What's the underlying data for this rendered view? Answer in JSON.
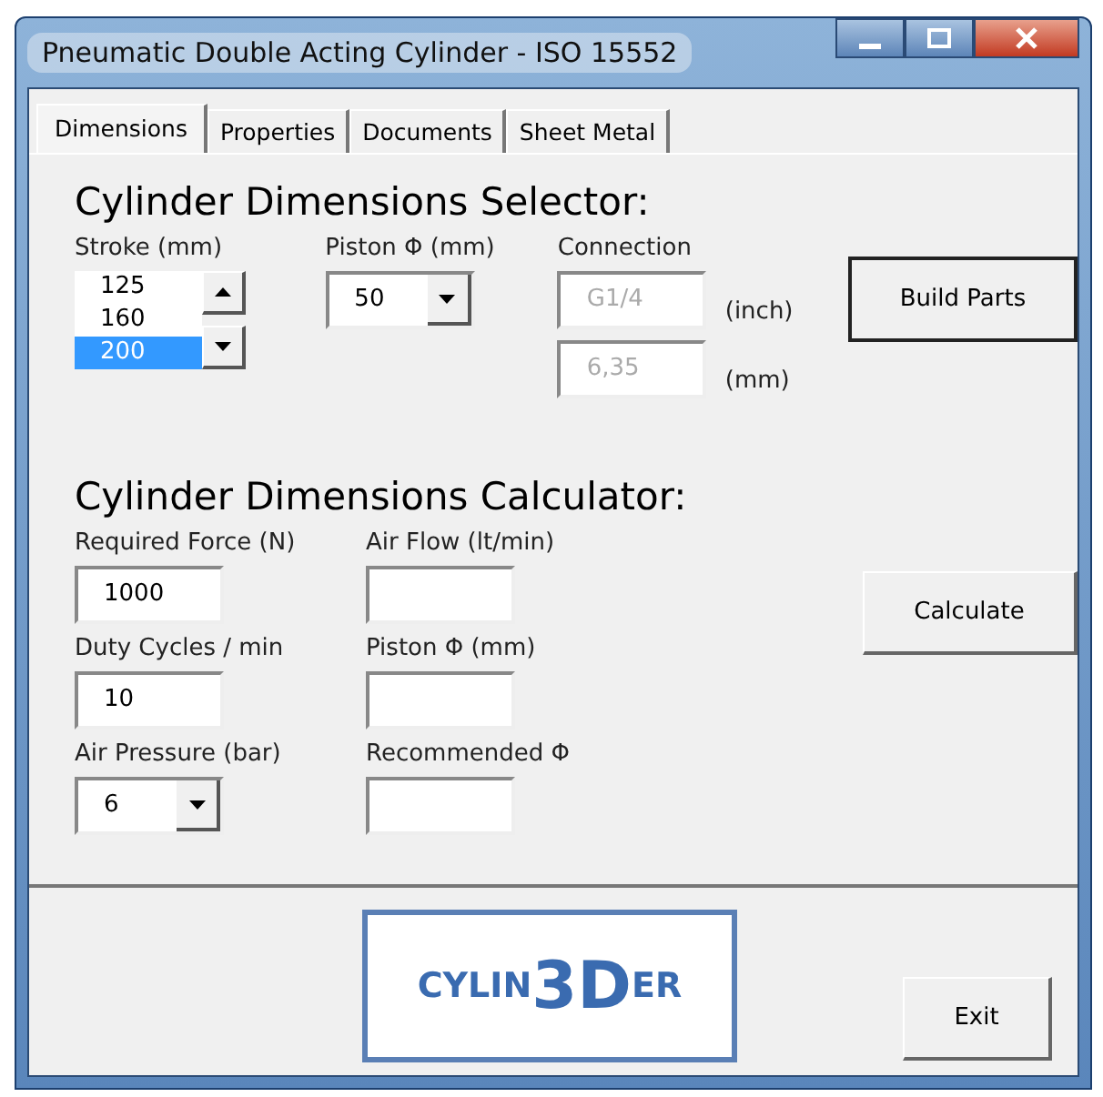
{
  "window": {
    "title": "Pneumatic Double Acting Cylinder - ISO 15552"
  },
  "tabs": [
    {
      "label": "Dimensions",
      "selected": true
    },
    {
      "label": "Properties",
      "selected": false
    },
    {
      "label": "Documents",
      "selected": false
    },
    {
      "label": "Sheet Metal",
      "selected": false
    }
  ],
  "selector": {
    "heading": "Cylinder Dimensions Selector:",
    "stroke": {
      "label": "Stroke (mm)",
      "options": [
        {
          "text": "125",
          "selected": false
        },
        {
          "text": "160",
          "selected": false
        },
        {
          "text": "200",
          "selected": true
        }
      ]
    },
    "piston": {
      "label": "Piston Φ (mm)",
      "value": "50"
    },
    "connection": {
      "label": "Connection",
      "disabled": true,
      "fields": [
        {
          "value": "G1/4",
          "unit": "(inch)"
        },
        {
          "value": "6,35",
          "unit": "(mm)"
        }
      ]
    },
    "button": "Build Parts"
  },
  "calculator": {
    "heading": "Cylinder Dimensions Calculator:",
    "fields": [
      {
        "label": "Required Force (N)",
        "kind": "text",
        "value": "1000"
      },
      {
        "label": "Air Flow (lt/min)",
        "kind": "text"
      },
      {
        "label": "Duty Cycles / min",
        "kind": "text",
        "value": "10"
      },
      {
        "label": "Piston Φ (mm)",
        "kind": "text"
      },
      {
        "label": "Air Pressure (bar)",
        "kind": "combo",
        "value": "6"
      },
      {
        "label": "Recommended Φ",
        "kind": "text"
      }
    ],
    "button": "Calculate"
  },
  "logo": {
    "parts": [
      {
        "text": "CYLIN",
        "kind": "small"
      },
      {
        "text": "3D",
        "kind": "large"
      },
      {
        "text": "ER",
        "kind": "small"
      }
    ]
  },
  "exit_button": "Exit"
}
